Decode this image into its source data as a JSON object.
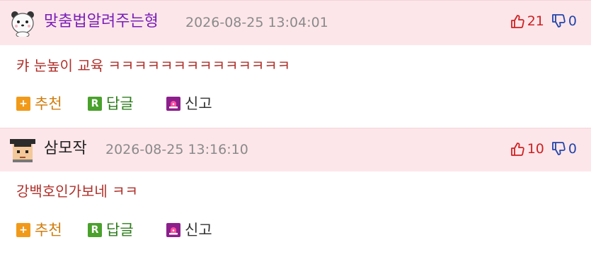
{
  "comments": [
    {
      "nickname": "맞춤법알려주는형",
      "time": "2026-08-25 13:04:01",
      "up": "21",
      "down": "0",
      "text": "캬 눈높이 교육 ㅋㅋㅋㅋㅋㅋㅋㅋㅋㅋㅋㅋㅋㅋ",
      "avatar_icon": "panda-avatar-icon"
    },
    {
      "nickname": "삼모작",
      "time": "2026-08-25 13:16:10",
      "up": "10",
      "down": "0",
      "text": "강백호인가보네 ㅋㅋ",
      "avatar_icon": "graduate-avatar-icon"
    }
  ],
  "actions": {
    "recommend_label": "추천",
    "reply_label": "답글",
    "report_label": "신고",
    "recommend_icon_glyph": "+",
    "reply_icon_glyph": "R"
  },
  "colors": {
    "header_bg": "#fde6ea",
    "nickname_purple": "#7a1fb8",
    "comment_text": "#b0302a",
    "upvote_red": "#cc2222",
    "downvote_blue": "#2244aa"
  }
}
